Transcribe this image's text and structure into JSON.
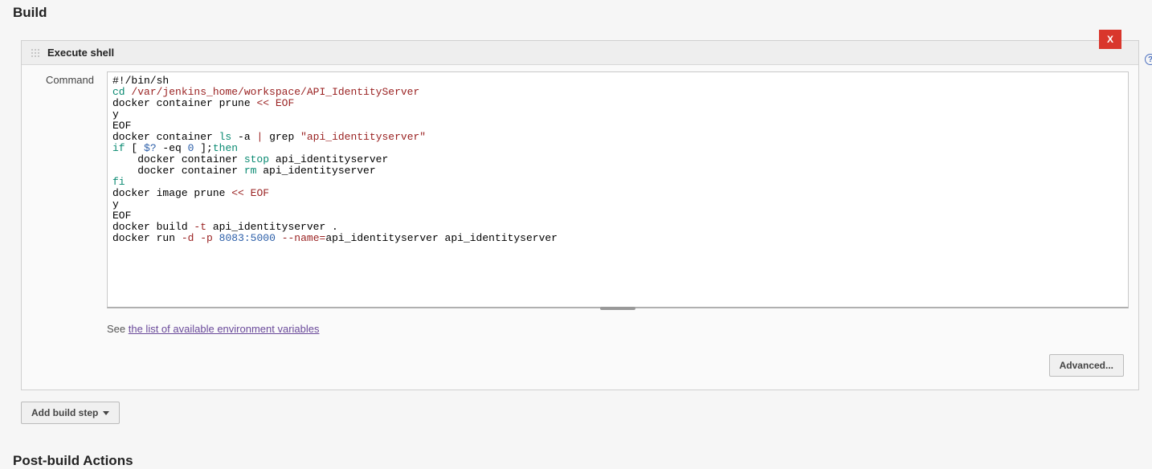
{
  "sections": {
    "build_title": "Build",
    "post_build_title": "Post-build Actions"
  },
  "build_step": {
    "title": "Execute shell",
    "delete_label": "X",
    "help_tooltip": "?",
    "field_label": "Command",
    "hint_prefix": "See ",
    "hint_link": "the list of available environment variables",
    "advanced_button": "Advanced...",
    "script": {
      "shebang": "#!/bin/sh",
      "cd_cmd": "cd",
      "cd_path": "/var/jenkins_home/workspace/API_IdentityServer",
      "prune1_a": "docker container prune ",
      "prune1_b": "<< EOF",
      "y1": "y",
      "eof1": "EOF",
      "ls_a": "docker container ",
      "ls_cmd": "ls",
      "ls_flag": " -a ",
      "ls_pipe": "| ",
      "grep": "grep ",
      "grep_arg": "\"api_identityserver\"",
      "if_a": "if",
      "if_b": " [ ",
      "if_var": "$?",
      "if_eq": " -eq ",
      "if_zero": "0",
      "if_c": " ];",
      "if_then": "then",
      "stop_a": "    docker container ",
      "stop_cmd": "stop",
      "stop_b": " api_identityserver",
      "rm_a": "    docker container ",
      "rm_cmd": "rm",
      "rm_b": " api_identityserver",
      "fi": "fi",
      "iprune_a": "docker image prune ",
      "iprune_b": "<< EOF",
      "y2": "y",
      "eof2": "EOF",
      "build_a": "docker build ",
      "build_flag": "-t",
      "build_b": " api_identityserver .",
      "run_a": "docker run ",
      "run_d": "-d",
      "run_sp1": " ",
      "run_p": "-p",
      "run_sp2": " ",
      "run_ports": "8083:5000",
      "run_sp3": " ",
      "run_name_flag": "--name",
      "run_eq": "=",
      "run_tail": "api_identityserver api_identityserver"
    }
  },
  "buttons": {
    "add_build_step": "Add build step"
  }
}
